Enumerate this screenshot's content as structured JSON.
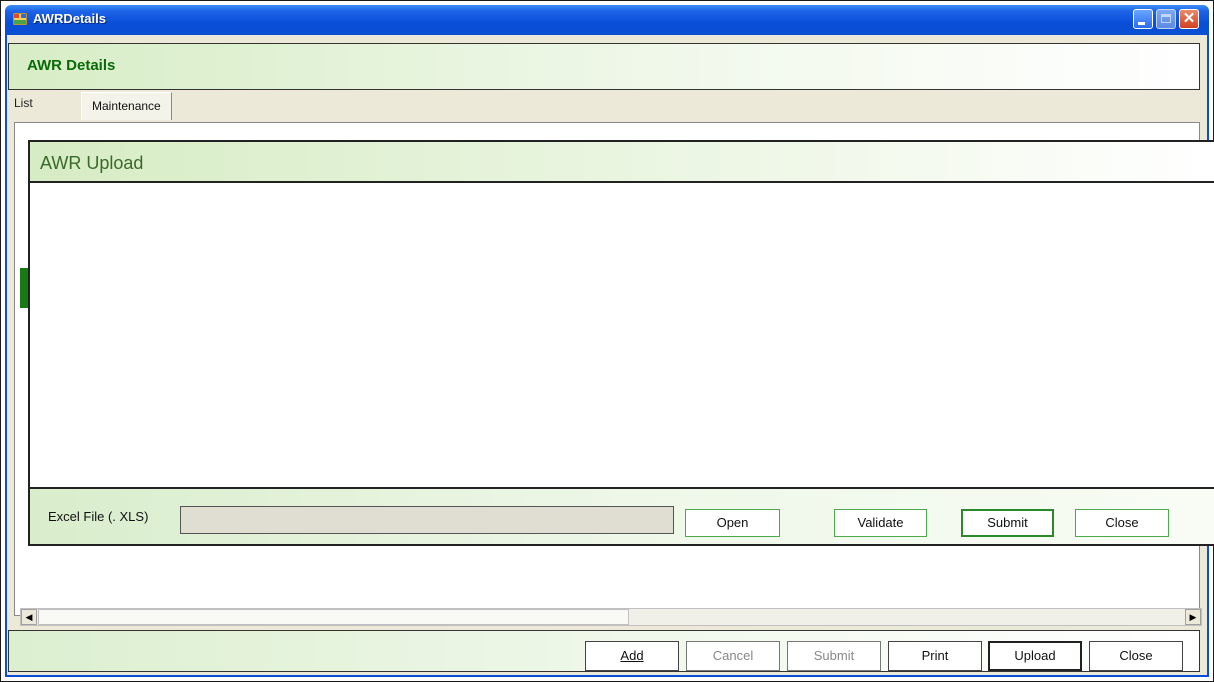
{
  "window": {
    "title": "AWRDetails"
  },
  "header": {
    "title": "AWR Details"
  },
  "tabs": [
    {
      "label": "List"
    },
    {
      "label": "Maintenance"
    }
  ],
  "dialog": {
    "title": "AWR Upload",
    "file_label": "Excel File (. XLS)",
    "file_value": "",
    "buttons": {
      "open": "Open",
      "validate": "Validate",
      "submit": "Submit",
      "close": "Close"
    }
  },
  "footer": {
    "buttons": {
      "add": "Add",
      "cancel": "Cancel",
      "submit": "Submit",
      "print": "Print",
      "upload": "Upload",
      "close": "Close"
    }
  },
  "colors": {
    "title_bar": "#0a4ed8",
    "header_text": "#0a6a0a",
    "accent_green": "#177a17"
  },
  "icons": {
    "app": "app-window-icon",
    "minimize": "minimize-icon",
    "maximize": "maximize-icon",
    "close": "close-icon",
    "scroll_left": "arrow-left-icon",
    "scroll_right": "arrow-right-icon"
  }
}
